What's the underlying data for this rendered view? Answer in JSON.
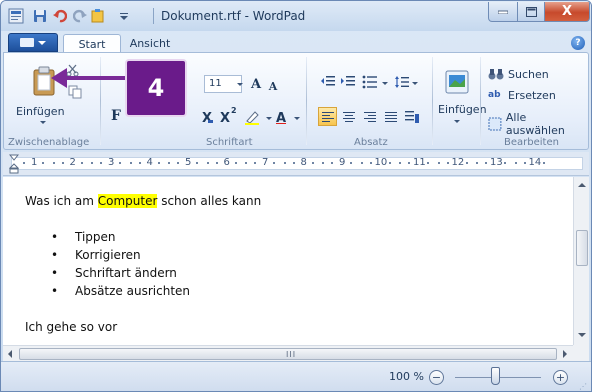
{
  "window": {
    "title": "Dokument.rtf - WordPad",
    "close_label": "X"
  },
  "tabs": [
    {
      "label": "Start"
    },
    {
      "label": "Ansicht"
    }
  ],
  "ribbon": {
    "clipboard": {
      "paste_label": "Einfügen",
      "group_label": "Zwischenablage"
    },
    "font": {
      "size_value": "11",
      "grow_label": "A",
      "shrink_label": "A",
      "bold_label": "F",
      "subscript_label": "X",
      "superscript_label": "X",
      "sub_suffix": "2",
      "font_color_label": "A",
      "group_label": "Schriftart"
    },
    "paragraph": {
      "group_label": "Absatz"
    },
    "insert": {
      "label": "Einfügen"
    },
    "editing": {
      "find_label": "Suchen",
      "replace_label": "Ersetzen",
      "replace_icon_text": "ab",
      "select_all_label": "Alle auswählen",
      "group_label": "Bearbeiten"
    }
  },
  "ruler": {
    "numbers": [
      "1",
      "2",
      "3",
      "4",
      "5",
      "6",
      "7",
      "8",
      "9",
      "10",
      "11",
      "12",
      "13",
      "14"
    ]
  },
  "document": {
    "title_before": "Was ich am ",
    "title_highlight": "Computer",
    "title_after": " schon alles kann",
    "bullets": [
      "Tippen",
      "Korrigieren",
      "Schriftart ändern",
      "Absätze ausrichten"
    ],
    "paragraph": "Ich gehe so vor"
  },
  "statusbar": {
    "zoom": "100 %",
    "zoom_out": "−",
    "zoom_in": "+"
  },
  "callout": {
    "step": "4"
  },
  "colors": {
    "highlight": "#ffff00",
    "callout": "#6a1b8a",
    "close_button": "#c74a2c"
  }
}
